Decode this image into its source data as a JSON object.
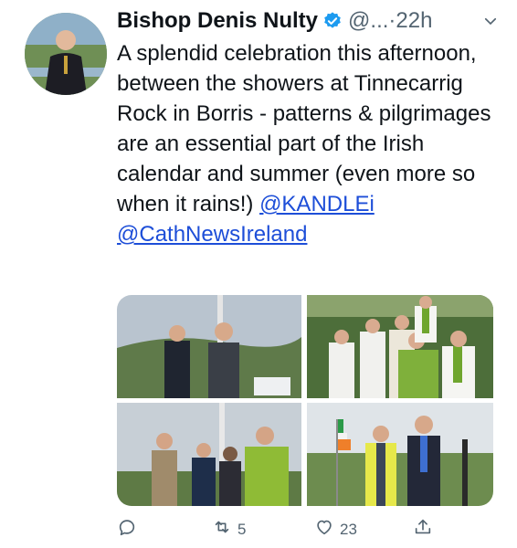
{
  "tweet": {
    "author_name": "Bishop Denis Nulty",
    "handle": "@...",
    "time": "·22h",
    "text_main": "A splendid celebration this afternoon, between the showers at Tinnecarrig Rock in Borris - patterns & pilgrimages are an essential part of the Irish calendar and summer (even more so when it rains!) ",
    "mention_1": "@KANDLEi",
    "mention_2": "@CathNewsIreland"
  },
  "actions": {
    "reply_count": "",
    "retweet_count": "5",
    "like_count": "23"
  },
  "icons": [
    "verified-badge-icon",
    "chevron-down-icon",
    "reply-icon",
    "retweet-icon",
    "like-icon",
    "share-icon"
  ],
  "colors": {
    "link": "#1d4ed8",
    "verified": "#1d9bf0",
    "muted": "#536471"
  }
}
